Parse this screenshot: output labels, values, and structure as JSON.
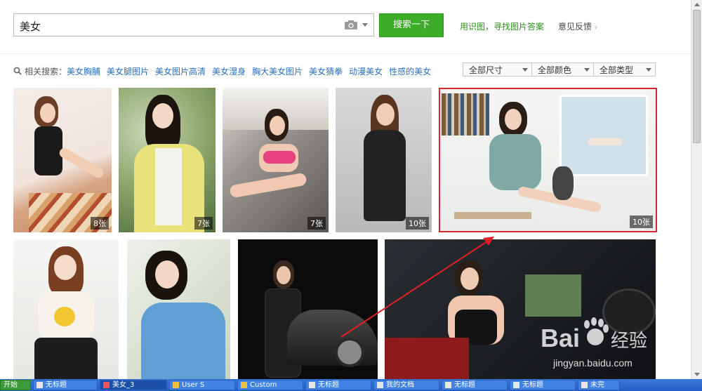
{
  "search": {
    "query": "美女",
    "button_label": "搜索一下",
    "shitu_label": "用识图，寻找图片答案",
    "feedback_label": "意见反馈"
  },
  "related": {
    "label": "相关搜索：",
    "items": [
      "美女胸脯",
      "美女腿图片",
      "美女图片高清",
      "美女湿身",
      "胸大美女图片",
      "美女猜拳",
      "动漫美女",
      "性感的美女"
    ]
  },
  "filters": [
    "全部尺寸",
    "全部颜色",
    "全部类型"
  ],
  "results": {
    "row1": [
      {
        "count": "8张"
      },
      {
        "count": "7张"
      },
      {
        "count": "7张"
      },
      {
        "count": "10张"
      },
      {
        "count": "10张"
      }
    ]
  },
  "watermark": {
    "brand": "Bai",
    "brand_suffix": "经验",
    "url": "jingyan.baidu.com"
  },
  "taskbar": {
    "start": "开始",
    "items": [
      "无标题",
      "美女_3",
      "User S",
      "Custom",
      "无标题",
      "我的文档",
      "无标题",
      "无标题",
      "未完"
    ]
  },
  "colors": {
    "accent_green": "#3dac29",
    "link_blue": "#2a6fbf",
    "highlight_red": "#d9272e",
    "taskbar_blue": "#245ec6"
  }
}
